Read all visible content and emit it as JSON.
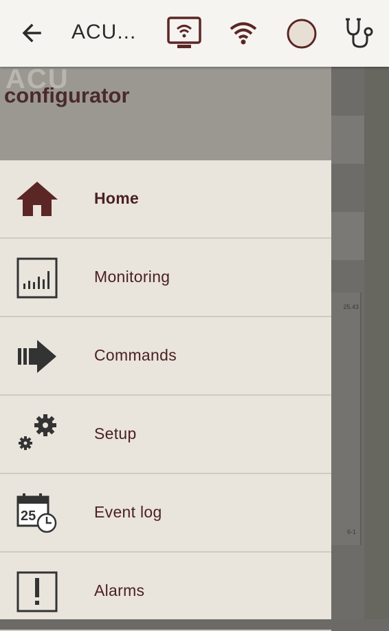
{
  "appbar": {
    "title": "ACU...",
    "icons": [
      "back-arrow-icon",
      "remote-display-icon",
      "wifi-icon",
      "status-circle-icon",
      "stethoscope-icon"
    ]
  },
  "drawer": {
    "header_brand": "ACU",
    "header_title": "configurator",
    "items": [
      {
        "label": "Home",
        "icon": "home-icon",
        "active": true
      },
      {
        "label": "Monitoring",
        "icon": "monitoring-chart-icon",
        "active": false
      },
      {
        "label": "Commands",
        "icon": "commands-arrow-icon",
        "active": false
      },
      {
        "label": "Setup",
        "icon": "gears-icon",
        "active": false
      },
      {
        "label": "Event log",
        "icon": "calendar-clock-icon",
        "active": false
      },
      {
        "label": "Alarms",
        "icon": "alarm-exclamation-icon",
        "active": false
      }
    ]
  },
  "background": {
    "card_text_top": "25.43",
    "card_text_bottom": "6-1"
  },
  "colors": {
    "brand": "#5b2626",
    "drawer_bg": "#e9e4dc",
    "header_bg": "#9b9892",
    "appbar_bg": "#f5f4f0"
  }
}
